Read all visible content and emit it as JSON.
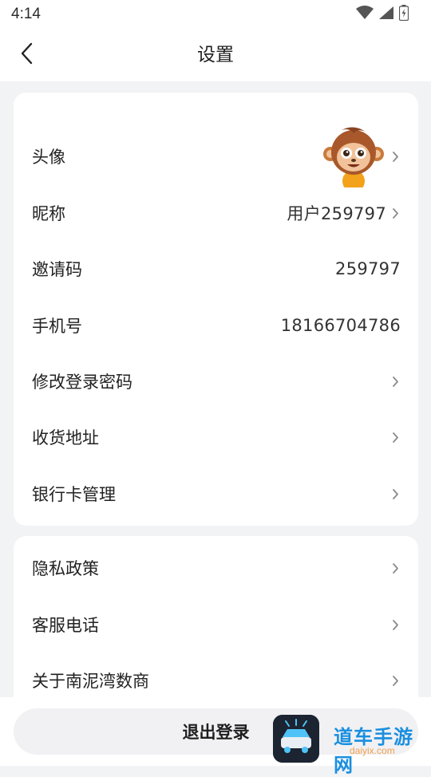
{
  "status_bar": {
    "time": "4:14",
    "icons": [
      "wifi-icon",
      "signal-icon",
      "battery-icon"
    ]
  },
  "nav": {
    "title": "设置",
    "back_icon": "chevron-left-icon"
  },
  "profile_section": {
    "items": [
      {
        "label": "头像",
        "value": "",
        "has_avatar": true,
        "chevron": true
      },
      {
        "label": "昵称",
        "value": "用户259797",
        "chevron": true
      },
      {
        "label": "邀请码",
        "value": "259797",
        "chevron": false
      },
      {
        "label": "手机号",
        "value": "18166704786",
        "chevron": false
      },
      {
        "label": "修改登录密码",
        "value": "",
        "chevron": true
      },
      {
        "label": "收货地址",
        "value": "",
        "chevron": true
      },
      {
        "label": "银行卡管理",
        "value": "",
        "chevron": true
      }
    ]
  },
  "info_section": {
    "items": [
      {
        "label": "隐私政策",
        "chevron": true
      },
      {
        "label": "客服电话",
        "chevron": true
      },
      {
        "label": "关于南泥湾数商",
        "chevron": true
      }
    ]
  },
  "logout_label": "退出登录",
  "watermark": {
    "text": "道车手游网",
    "sub": "daiyix.com"
  },
  "colors": {
    "page_bg": "#f2f3f5",
    "card_bg": "#ffffff",
    "logout_bg": "#f1f1f3",
    "chevron": "#8a8a8a"
  }
}
